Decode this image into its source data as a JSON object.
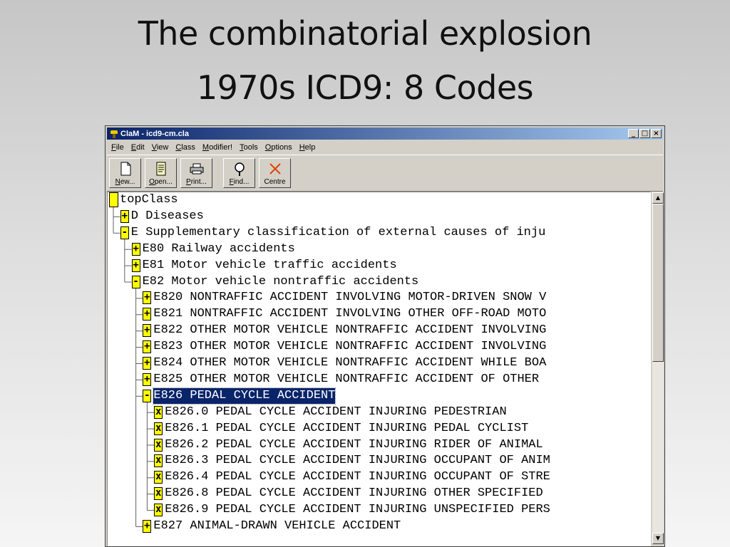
{
  "slide": {
    "title_line1": "The combinatorial explosion",
    "title_line2": "1970s ICD9: 8 Codes"
  },
  "window": {
    "title": "ClaM - icd9-cm.cla",
    "buttons": {
      "minimize": "_",
      "maximize": "□",
      "close": "×"
    }
  },
  "menu": [
    {
      "u": "F",
      "rest": "ile"
    },
    {
      "u": "E",
      "rest": "dit"
    },
    {
      "u": "V",
      "rest": "iew"
    },
    {
      "u": "C",
      "rest": "lass"
    },
    {
      "u": "M",
      "rest": "odifier!"
    },
    {
      "u": "T",
      "rest": "ools"
    },
    {
      "u": "O",
      "rest": "ptions"
    },
    {
      "u": "H",
      "rest": "elp"
    }
  ],
  "toolbar": [
    {
      "u": "N",
      "rest": "ew...",
      "icon": "new-document-icon"
    },
    {
      "u": "O",
      "rest": "pen...",
      "icon": "open-file-icon"
    },
    {
      "u": "P",
      "rest": "rint...",
      "icon": "printer-icon"
    },
    {
      "u": "F",
      "rest": "ind...",
      "icon": "magnifier-icon"
    },
    {
      "u": "",
      "rest": "Centre",
      "icon": "centre-cross-icon"
    }
  ],
  "tree": [
    {
      "level": 0,
      "expander": "",
      "text": "topClass"
    },
    {
      "level": 1,
      "expander": "+",
      "text": "D Diseases"
    },
    {
      "level": 1,
      "expander": "-",
      "text": "E Supplementary classification of external causes of inju"
    },
    {
      "level": 2,
      "expander": "+",
      "text": "E80 Railway accidents"
    },
    {
      "level": 2,
      "expander": "+",
      "text": "E81 Motor vehicle traffic accidents"
    },
    {
      "level": 2,
      "expander": "-",
      "text": "E82 Motor vehicle nontraffic accidents"
    },
    {
      "level": 3,
      "expander": "+",
      "text": "E820 NONTRAFFIC ACCIDENT INVOLVING MOTOR-DRIVEN SNOW V"
    },
    {
      "level": 3,
      "expander": "+",
      "text": "E821 NONTRAFFIC ACCIDENT INVOLVING OTHER OFF-ROAD MOTO"
    },
    {
      "level": 3,
      "expander": "+",
      "text": "E822 OTHER MOTOR VEHICLE NONTRAFFIC ACCIDENT INVOLVING"
    },
    {
      "level": 3,
      "expander": "+",
      "text": "E823 OTHER MOTOR VEHICLE NONTRAFFIC ACCIDENT INVOLVING"
    },
    {
      "level": 3,
      "expander": "+",
      "text": "E824 OTHER MOTOR VEHICLE NONTRAFFIC ACCIDENT WHILE BOA"
    },
    {
      "level": 3,
      "expander": "+",
      "text": "E825 OTHER MOTOR VEHICLE NONTRAFFIC ACCIDENT OF OTHER"
    },
    {
      "level": 3,
      "expander": "-",
      "text": "E826 PEDAL CYCLE ACCIDENT",
      "selected": true
    },
    {
      "level": 4,
      "expander": "x",
      "text": "E826.0 PEDAL CYCLE ACCIDENT INJURING PEDESTRIAN"
    },
    {
      "level": 4,
      "expander": "x",
      "text": "E826.1 PEDAL CYCLE ACCIDENT INJURING PEDAL CYCLIST"
    },
    {
      "level": 4,
      "expander": "x",
      "text": "E826.2 PEDAL CYCLE ACCIDENT INJURING RIDER OF ANIMAL"
    },
    {
      "level": 4,
      "expander": "x",
      "text": "E826.3 PEDAL CYCLE ACCIDENT INJURING OCCUPANT OF ANIM"
    },
    {
      "level": 4,
      "expander": "x",
      "text": "E826.4 PEDAL CYCLE ACCIDENT INJURING OCCUPANT OF STRE"
    },
    {
      "level": 4,
      "expander": "x",
      "text": "E826.8 PEDAL CYCLE ACCIDENT INJURING OTHER SPECIFIED"
    },
    {
      "level": 4,
      "expander": "x",
      "text": "E826.9 PEDAL CYCLE ACCIDENT INJURING UNSPECIFIED PERS"
    },
    {
      "level": 3,
      "expander": "+",
      "text": "E827 ANIMAL-DRAWN VEHICLE ACCIDENT"
    }
  ],
  "scrollbar": {
    "up": "▲",
    "down": "▼"
  }
}
